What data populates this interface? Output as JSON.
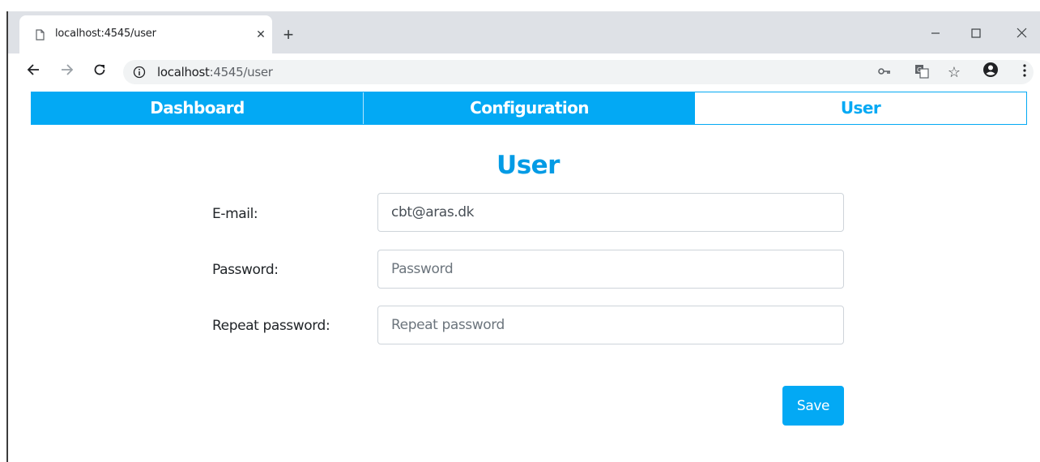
{
  "browser": {
    "tab_title": "localhost:4545/user",
    "new_tab_symbol": "+",
    "url_host": "localhost",
    "url_path": ":4545/user",
    "icons": [
      "page-icon",
      "close-icon",
      "new-tab-icon",
      "minimize-icon",
      "maximize-icon",
      "close-window-icon",
      "back-icon",
      "forward-icon",
      "reload-icon",
      "info-icon",
      "key-icon",
      "translate-icon",
      "star-icon",
      "profile-icon",
      "menu-icon"
    ]
  },
  "nav": {
    "items": [
      {
        "label": "Dashboard",
        "active": false
      },
      {
        "label": "Configuration",
        "active": false
      },
      {
        "label": "User",
        "active": true
      }
    ]
  },
  "page": {
    "title": "User"
  },
  "form": {
    "email_label": "E-mail:",
    "email_value": "cbt@aras.dk",
    "password_label": "Password:",
    "password_placeholder": "Password",
    "repeat_label": "Repeat password:",
    "repeat_placeholder": "Repeat password",
    "save_label": "Save"
  },
  "colors": {
    "accent": "#03a9f4",
    "title": "#039be5"
  }
}
